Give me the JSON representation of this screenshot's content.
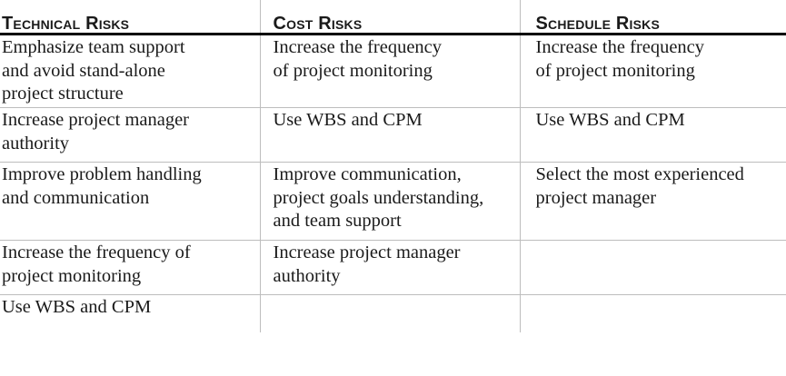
{
  "headers": [
    "Technical Risks",
    "Cost Risks",
    "Schedule Risks"
  ],
  "rows": [
    [
      "Emphasize team support\nand avoid stand-alone\nproject structure",
      "Increase the frequency\nof project monitoring",
      "Increase the frequency\nof project monitoring"
    ],
    [
      "Increase project manager\nauthority",
      "Use WBS and CPM",
      "Use WBS and CPM"
    ],
    [
      "Improve problem handling\nand communication",
      "Improve communication,\nproject goals understanding,\nand team support",
      "Select the most experienced\nproject manager"
    ],
    [
      "Increase the frequency of\nproject monitoring",
      "Increase project manager\nauthority",
      ""
    ],
    [
      "Use WBS and CPM",
      "",
      ""
    ]
  ]
}
